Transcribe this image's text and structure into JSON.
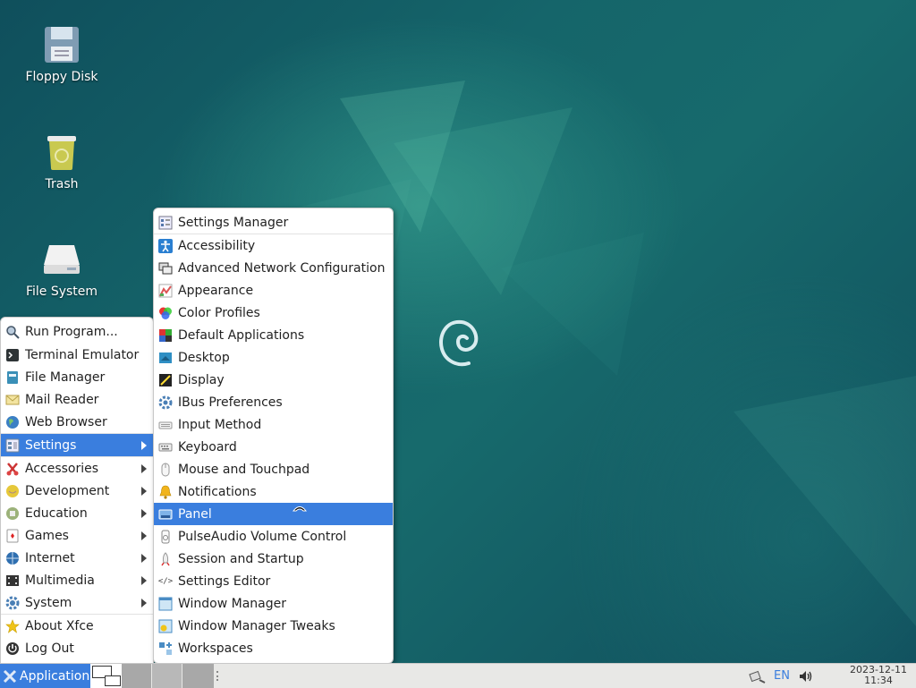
{
  "desktop": {
    "icons": [
      {
        "label": "Floppy Disk",
        "icon": "floppy-disk-icon"
      },
      {
        "label": "Trash",
        "icon": "trash-icon"
      },
      {
        "label": "File System",
        "icon": "drive-icon"
      }
    ]
  },
  "app_menu": {
    "items": [
      {
        "label": "Run Program...",
        "icon": "search-icon"
      },
      {
        "label": "Terminal Emulator",
        "icon": "terminal-icon"
      },
      {
        "label": "File Manager",
        "icon": "file-manager-icon"
      },
      {
        "label": "Mail Reader",
        "icon": "mail-icon"
      },
      {
        "label": "Web Browser",
        "icon": "globe-icon"
      },
      {
        "label": "Settings",
        "icon": "settings-icon",
        "submenu": true,
        "selected": true
      },
      {
        "label": "Accessories",
        "icon": "accessories-icon",
        "submenu": true
      },
      {
        "label": "Development",
        "icon": "development-icon",
        "submenu": true
      },
      {
        "label": "Education",
        "icon": "education-icon",
        "submenu": true
      },
      {
        "label": "Games",
        "icon": "cards-icon",
        "submenu": true
      },
      {
        "label": "Internet",
        "icon": "globe-icon",
        "submenu": true
      },
      {
        "label": "Multimedia",
        "icon": "multimedia-icon",
        "submenu": true
      },
      {
        "label": "System",
        "icon": "gear-icon",
        "submenu": true
      },
      {
        "label": "About Xfce",
        "icon": "star-icon"
      },
      {
        "label": "Log Out",
        "icon": "logout-icon"
      }
    ]
  },
  "settings_menu": {
    "items": [
      {
        "label": "Settings Manager",
        "icon": "settings-manager-icon"
      },
      {
        "label": "Accessibility",
        "icon": "accessibility-icon"
      },
      {
        "label": "Advanced Network Configuration",
        "icon": "network-icon"
      },
      {
        "label": "Appearance",
        "icon": "appearance-icon"
      },
      {
        "label": "Color Profiles",
        "icon": "color-profiles-icon"
      },
      {
        "label": "Default Applications",
        "icon": "default-apps-icon"
      },
      {
        "label": "Desktop",
        "icon": "desktop-icon"
      },
      {
        "label": "Display",
        "icon": "display-icon"
      },
      {
        "label": "IBus Preferences",
        "icon": "ibus-icon"
      },
      {
        "label": "Input Method",
        "icon": "input-method-icon"
      },
      {
        "label": "Keyboard",
        "icon": "keyboard-icon"
      },
      {
        "label": "Mouse and Touchpad",
        "icon": "mouse-icon"
      },
      {
        "label": "Notifications",
        "icon": "bell-icon"
      },
      {
        "label": "Panel",
        "icon": "panel-icon",
        "selected": true
      },
      {
        "label": "PulseAudio Volume Control",
        "icon": "volume-control-icon"
      },
      {
        "label": "Session and Startup",
        "icon": "rocket-icon"
      },
      {
        "label": "Settings Editor",
        "icon": "settings-editor-icon"
      },
      {
        "label": "Window Manager",
        "icon": "window-manager-icon"
      },
      {
        "label": "Window Manager Tweaks",
        "icon": "window-tweaks-icon"
      },
      {
        "label": "Workspaces",
        "icon": "workspaces-icon"
      }
    ]
  },
  "taskbar": {
    "applications_label": "Applications",
    "keyboard_layout": "EN",
    "clock_date": "2023-12-11",
    "clock_time": "11:34"
  },
  "colors": {
    "accent": "#3a7ede",
    "desktop_bg": "#15656a"
  }
}
